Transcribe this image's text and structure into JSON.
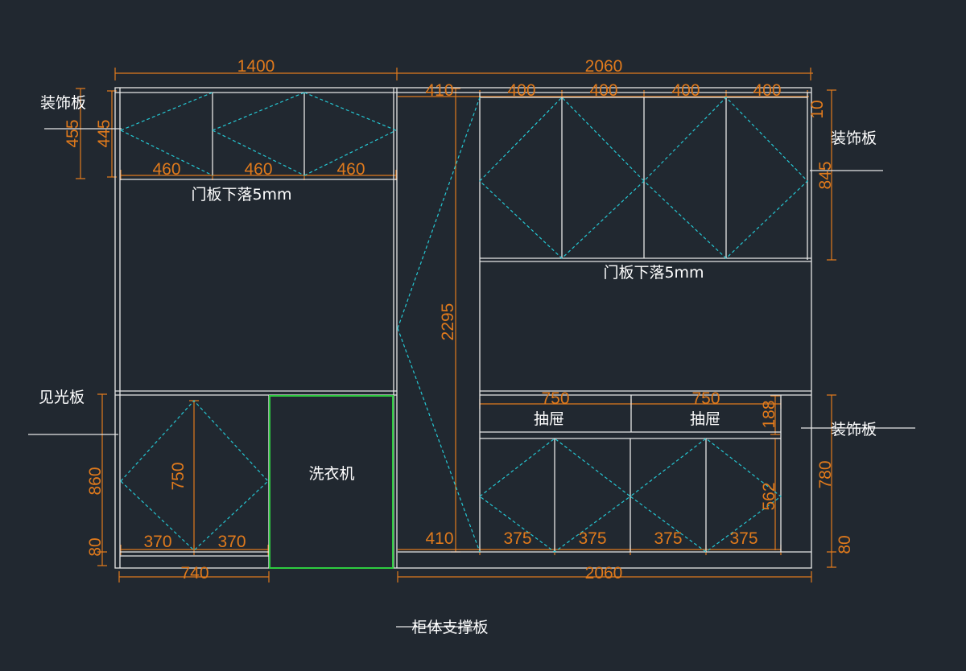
{
  "colors": {
    "background": "#212830",
    "lines": "#e6e6e6",
    "dimensions": "#e07a1c",
    "hidden_lines": "#25c7d3",
    "washer": "#2ecc40"
  },
  "dimensions": {
    "top_left_width": "1400",
    "top_right_width": "2060",
    "bottom_left_width": "740",
    "bottom_right_width": "2060",
    "top_row": [
      "410",
      "400",
      "400",
      "400",
      "400"
    ],
    "top_right_small": "10",
    "upper_left_doors": [
      "460",
      "460",
      "460"
    ],
    "left_outer_455": "455",
    "left_inner_445": "445",
    "right_845": "845",
    "center_2295": "2295",
    "left_860": "860",
    "left_80": "80",
    "lower_left_750": "750",
    "lower_left_doors": [
      "370",
      "370"
    ],
    "drawer_widths": [
      "750",
      "750"
    ],
    "drawer_188": "188",
    "right_780": "780",
    "right_80": "80",
    "lower_right_562": "562",
    "bottom_410": "410",
    "lower_right_doors": [
      "375",
      "375",
      "375",
      "375"
    ]
  },
  "labels": {
    "deco_top_left": "装饰板",
    "deco_top_right": "装饰板",
    "deco_bottom_right": "装饰板",
    "light_panel": "见光板",
    "door_drop_left": "门板下落5mm",
    "door_drop_right": "门板下落5mm",
    "drawer_1": "抽屉",
    "drawer_2": "抽屉",
    "washer": "洗衣机",
    "support": "柜体支撑板"
  }
}
